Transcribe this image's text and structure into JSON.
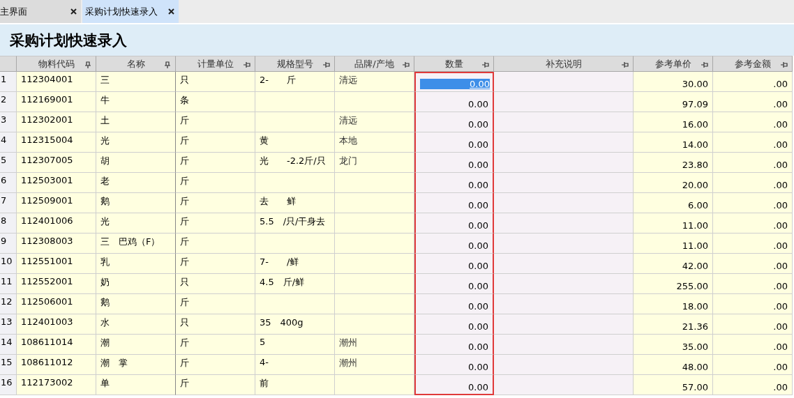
{
  "tabs": [
    {
      "label": "主界面",
      "selected": false
    },
    {
      "label": "采购计划快速录入",
      "selected": true
    }
  ],
  "title": "采购计划快速录入",
  "columns": [
    {
      "label": "物料代码",
      "pinned": true
    },
    {
      "label": "名称",
      "pinned": true
    },
    {
      "label": "计量单位",
      "pinned": false
    },
    {
      "label": "规格型号",
      "pinned": false
    },
    {
      "label": "品牌/产地",
      "pinned": false
    },
    {
      "label": "数量",
      "pinned": false
    },
    {
      "label": "补充说明",
      "pinned": false
    },
    {
      "label": "参考单价",
      "pinned": false
    },
    {
      "label": "参考金额",
      "pinned": false
    }
  ],
  "rows": [
    {
      "index": "1",
      "code": "112304001",
      "name": "三",
      "unit": "只",
      "spec": "2-　　斤",
      "brand": "清远",
      "qty": "0.00",
      "price": "30.00",
      "amount": ".00",
      "selected": true
    },
    {
      "index": "2",
      "code": "112169001",
      "name": "牛",
      "unit": "条",
      "spec": "",
      "brand": "",
      "qty": "0.00",
      "price": "97.09",
      "amount": ".00",
      "selected": false
    },
    {
      "index": "3",
      "code": "112302001",
      "name": "土",
      "unit": "斤",
      "spec": "",
      "brand": "清远",
      "qty": "0.00",
      "price": "16.00",
      "amount": ".00",
      "selected": false
    },
    {
      "index": "4",
      "code": "112315004",
      "name": "光",
      "unit": "斤",
      "spec": "黄",
      "brand": "本地",
      "qty": "0.00",
      "price": "14.00",
      "amount": ".00",
      "selected": false
    },
    {
      "index": "5",
      "code": "112307005",
      "name": "胡",
      "unit": "斤",
      "spec": "光　　-2.2斤/只",
      "brand": "龙门",
      "qty": "0.00",
      "price": "23.80",
      "amount": ".00",
      "selected": false
    },
    {
      "index": "6",
      "code": "112503001",
      "name": "老",
      "unit": "斤",
      "spec": "",
      "brand": "",
      "qty": "0.00",
      "price": "20.00",
      "amount": ".00",
      "selected": false
    },
    {
      "index": "7",
      "code": "112509001",
      "name": "鹅",
      "unit": "斤",
      "spec": "去　　鲜",
      "brand": "",
      "qty": "0.00",
      "price": "6.00",
      "amount": ".00",
      "selected": false
    },
    {
      "index": "8",
      "code": "112401006",
      "name": "光",
      "unit": "斤",
      "spec": "5.5　/只/干身去",
      "brand": "",
      "qty": "0.00",
      "price": "11.00",
      "amount": ".00",
      "selected": false
    },
    {
      "index": "9",
      "code": "112308003",
      "name": "三　巴鸡（F）",
      "unit": "斤",
      "spec": "",
      "brand": "",
      "qty": "0.00",
      "price": "11.00",
      "amount": ".00",
      "selected": false
    },
    {
      "index": "10",
      "code": "112551001",
      "name": "乳",
      "unit": "斤",
      "spec": "7-　　/鲜",
      "brand": "",
      "qty": "0.00",
      "price": "42.00",
      "amount": ".00",
      "selected": false
    },
    {
      "index": "11",
      "code": "112552001",
      "name": "奶",
      "unit": "只",
      "spec": "4.5　斤/鲜",
      "brand": "",
      "qty": "0.00",
      "price": "255.00",
      "amount": ".00",
      "selected": false
    },
    {
      "index": "12",
      "code": "112506001",
      "name": "鹅",
      "unit": "斤",
      "spec": "",
      "brand": "",
      "qty": "0.00",
      "price": "18.00",
      "amount": ".00",
      "selected": false
    },
    {
      "index": "13",
      "code": "112401003",
      "name": "水",
      "unit": "只",
      "spec": "35　400g",
      "brand": "",
      "qty": "0.00",
      "price": "21.36",
      "amount": ".00",
      "selected": false
    },
    {
      "index": "14",
      "code": "108611014",
      "name": "潮",
      "unit": "斤",
      "spec": "5",
      "brand": "潮州",
      "qty": "0.00",
      "price": "35.00",
      "amount": ".00",
      "selected": false
    },
    {
      "index": "15",
      "code": "108611012",
      "name": "潮　掌",
      "unit": "斤",
      "spec": "4-",
      "brand": "潮州",
      "qty": "0.00",
      "price": "48.00",
      "amount": ".00",
      "selected": false
    },
    {
      "index": "16",
      "code": "112173002",
      "name": "单",
      "unit": "斤",
      "spec": "前",
      "brand": "",
      "qty": "0.00",
      "price": "57.00",
      "amount": ".00",
      "selected": false
    }
  ]
}
